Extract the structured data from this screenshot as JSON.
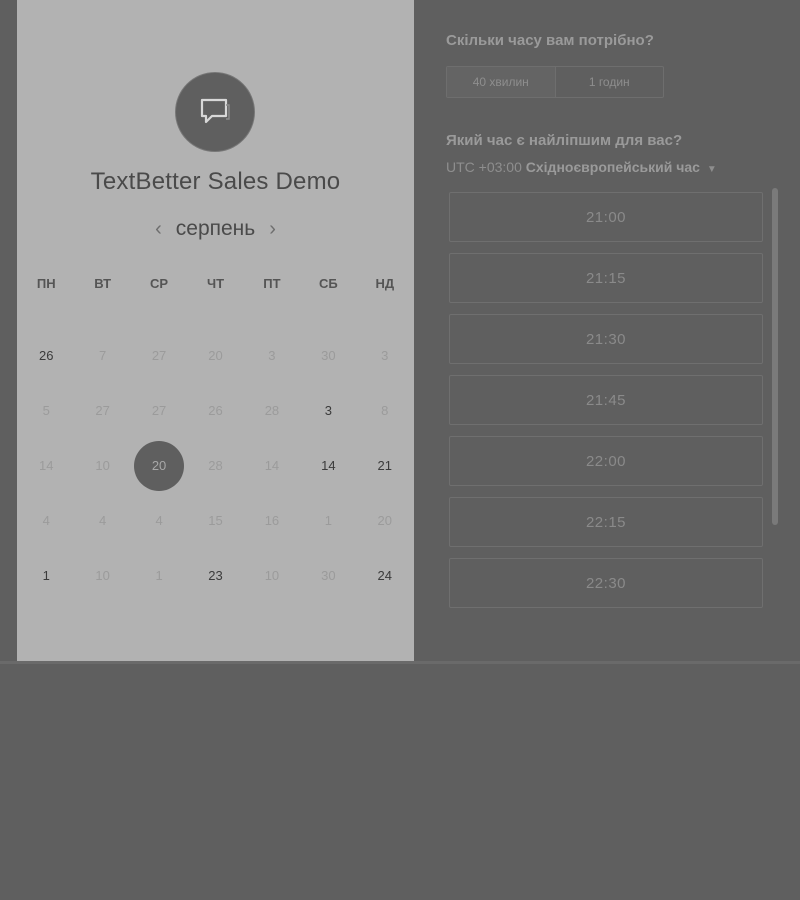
{
  "booking": {
    "title": "TextBetter Sales Demo",
    "logo_icon": "chat-bubble-icon"
  },
  "calendar": {
    "month": "серпень",
    "prev_icon": "chevron-left-icon",
    "next_icon": "chevron-right-icon",
    "weekdays": [
      "ПН",
      "ВТ",
      "СР",
      "ЧТ",
      "ПТ",
      "СБ",
      "НД"
    ],
    "weeks": [
      [
        {
          "d": "26",
          "s": "active"
        },
        {
          "d": "7",
          "s": "muted"
        },
        {
          "d": "27",
          "s": "muted"
        },
        {
          "d": "20",
          "s": "muted"
        },
        {
          "d": "3",
          "s": "muted"
        },
        {
          "d": "30",
          "s": "muted"
        },
        {
          "d": "3",
          "s": "muted"
        }
      ],
      [
        {
          "d": "5",
          "s": "muted"
        },
        {
          "d": "27",
          "s": "muted"
        },
        {
          "d": "27",
          "s": "muted"
        },
        {
          "d": "26",
          "s": "muted"
        },
        {
          "d": "28",
          "s": "muted"
        },
        {
          "d": "3",
          "s": "active"
        },
        {
          "d": "8",
          "s": "muted"
        }
      ],
      [
        {
          "d": "14",
          "s": "muted"
        },
        {
          "d": "10",
          "s": "muted"
        },
        {
          "d": "20",
          "s": "selected"
        },
        {
          "d": "28",
          "s": "muted"
        },
        {
          "d": "14",
          "s": "muted"
        },
        {
          "d": "14",
          "s": "active"
        },
        {
          "d": "21",
          "s": "active"
        }
      ],
      [
        {
          "d": "4",
          "s": "muted"
        },
        {
          "d": "4",
          "s": "muted"
        },
        {
          "d": "4",
          "s": "muted"
        },
        {
          "d": "15",
          "s": "muted"
        },
        {
          "d": "16",
          "s": "muted"
        },
        {
          "d": "1",
          "s": "muted"
        },
        {
          "d": "20",
          "s": "muted"
        }
      ],
      [
        {
          "d": "1",
          "s": "active"
        },
        {
          "d": "10",
          "s": "muted"
        },
        {
          "d": "1",
          "s": "muted"
        },
        {
          "d": "23",
          "s": "active"
        },
        {
          "d": "10",
          "s": "muted"
        },
        {
          "d": "30",
          "s": "muted"
        },
        {
          "d": "24",
          "s": "active"
        }
      ]
    ]
  },
  "duration": {
    "question": "Скільки часу вам потрібно?",
    "options": [
      "40 хвилин",
      "1 годин"
    ],
    "selected_index": 0
  },
  "time": {
    "question": "Який час є найліпшим для вас?",
    "timezone_offset": "UTC +03:00",
    "timezone_name": "Східноєвропейський час",
    "slots": [
      "21:00",
      "21:15",
      "21:30",
      "21:45",
      "22:00",
      "22:15",
      "22:30",
      ""
    ]
  }
}
